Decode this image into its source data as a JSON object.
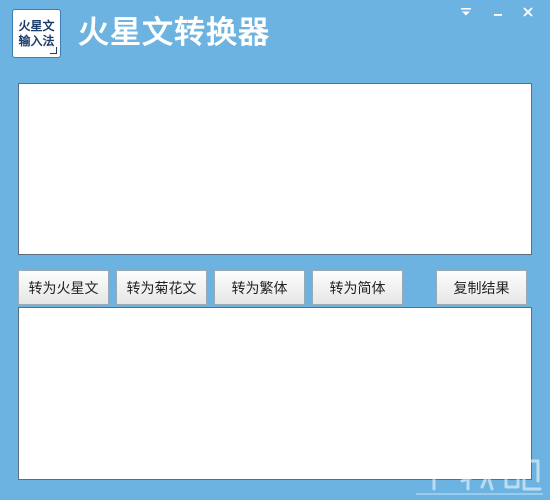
{
  "window": {
    "logo_lines": [
      "火星文",
      "输入法"
    ],
    "title": "火星文转换器",
    "controls": [
      "menu-icon",
      "minimize-icon",
      "close-icon"
    ]
  },
  "input": {
    "value": ""
  },
  "buttons": {
    "to_mars": "转为火星文",
    "to_chrysanthemum": "转为菊花文",
    "to_traditional": "转为繁体",
    "to_simplified": "转为简体",
    "copy_result": "复制结果"
  },
  "output": {
    "value": ""
  },
  "watermark": {
    "text": "下载吧"
  },
  "colors": {
    "window_bg": "#6cb3e2",
    "title_text": "#ffffff",
    "logo_text": "#1c3d6b",
    "textbox_border": "#5a6e80"
  }
}
